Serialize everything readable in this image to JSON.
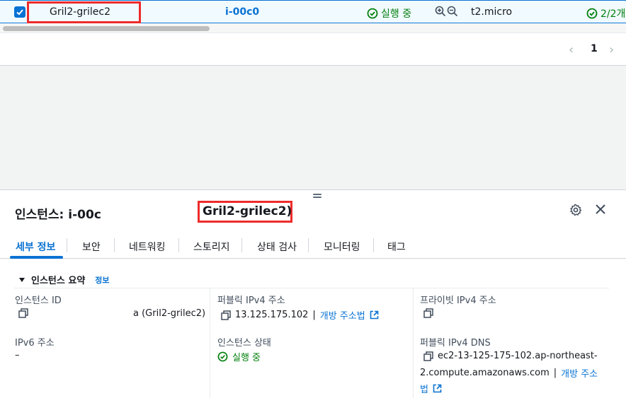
{
  "table_row": {
    "name": "Gril2-grilec2",
    "instance_id": "i-00c0",
    "state": "실행 중",
    "instance_type": "t2.micro",
    "status_check": "2/2개"
  },
  "pagination": {
    "current_page": "1",
    "prev_icon": "chevron-left-icon",
    "next_icon": "chevron-right-icon"
  },
  "panel": {
    "title": "인스턴스: i-00c",
    "title_name": "Gril2-grilec2)",
    "tabs": [
      "세부 정보",
      "보안",
      "네트워킹",
      "스토리지",
      "상태 검사",
      "모니터링",
      "태그"
    ],
    "section_title": "인스턴스 요약",
    "section_info": "정보"
  },
  "details": {
    "instance_id_label": "인스턴스 ID",
    "instance_id_value": "a (Gril2-grilec2)",
    "ipv6_label": "IPv6 주소",
    "ipv6_value": "–",
    "public_ipv4_label": "퍼블릭 IPv4 주소",
    "public_ipv4_value": "13.125.175.102",
    "public_ipv4_sep": "|",
    "open_address_link": "개방 주소법",
    "instance_state_label": "인스턴스 상태",
    "instance_state_value": "실행 중",
    "private_ipv4_label": "프라이빗 IPv4 주소",
    "public_dns_label": "퍼블릭 IPv4 DNS",
    "public_dns_line1": "ec2-13-125-175-102.ap-northeast-",
    "public_dns_line2": "2.compute.amazonaws.com",
    "dns_sep": "|",
    "open_address_link2a": "개방 주소",
    "open_address_link2b": "법"
  },
  "colors": {
    "accent": "#0972d3",
    "success": "#037f0c",
    "highlight_box": "#ee2b2b"
  }
}
